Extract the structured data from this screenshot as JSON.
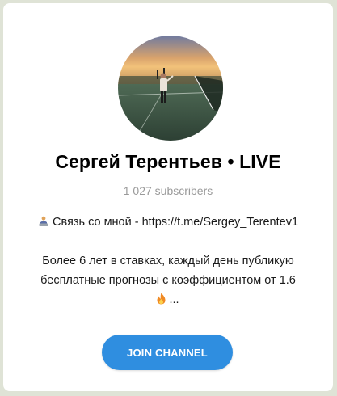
{
  "channel": {
    "name": "Сергей Терентьев • LIVE",
    "subscribers": "1 027 subscribers"
  },
  "description": {
    "contact_icon": "person-at-laptop-icon",
    "contact_line": "Связь со мной - https://t.me/Sergey_Terentev1",
    "line2": "Более 6 лет в ставках, каждый день публикую",
    "line3": "бесплатные прогнозы с коэффициентом от 1.6",
    "fire_icon": "fire-icon",
    "line4_suffix": "..."
  },
  "actions": {
    "join_label": "JOIN CHANNEL"
  },
  "colors": {
    "page_background": "#dfe3d6",
    "card_background": "#ffffff",
    "button": "#2f8ee0",
    "subscribers_text": "#9a9a9a"
  }
}
